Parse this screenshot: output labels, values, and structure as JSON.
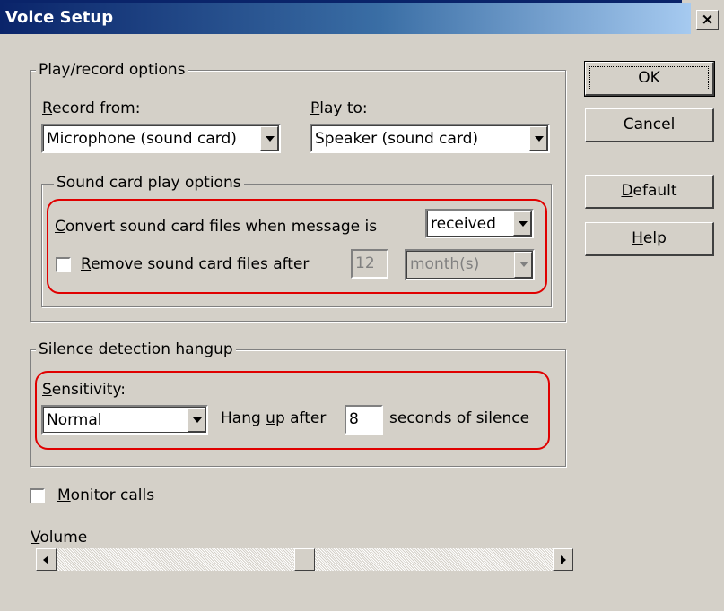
{
  "window": {
    "title": "Voice Setup",
    "close_glyph": "×"
  },
  "buttons": {
    "ok": "OK",
    "cancel": "Cancel",
    "default": "Default",
    "help": "Help"
  },
  "play_record": {
    "legend": "Play/record options",
    "record_from_label": "Record from:",
    "record_from_value": "Microphone (sound card)",
    "play_to_label": "Play to:",
    "play_to_value": "Speaker (sound card)"
  },
  "sound_card": {
    "legend": "Sound card play options",
    "convert_label": "Convert sound card files when message is",
    "convert_value": "received",
    "remove_label": "Remove sound card files after",
    "remove_checked": false,
    "remove_count": "12",
    "remove_unit": "month(s)"
  },
  "silence": {
    "legend": "Silence detection hangup",
    "sensitivity_label": "Sensitivity:",
    "sensitivity_value": "Normal",
    "hang_up_label": "Hang up after",
    "hang_up_seconds": "8",
    "seconds_label": "seconds of silence"
  },
  "monitor_calls": {
    "label": "Monitor calls",
    "checked": false
  },
  "volume": {
    "label": "Volume",
    "level_fraction": 0.5
  },
  "colors": {
    "highlight": "#e00000",
    "titlebar": "#0a246a",
    "face": "#d4d0c8"
  }
}
